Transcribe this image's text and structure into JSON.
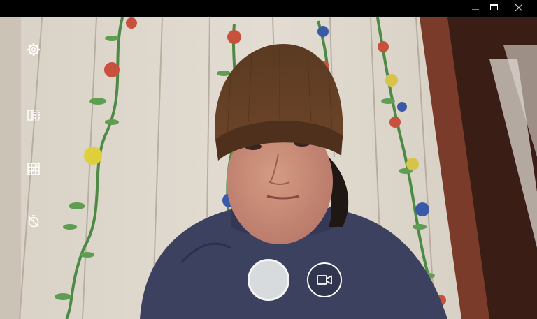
{
  "window": {
    "controls": {
      "minimize_icon": "minimize-icon",
      "maximize_icon": "maximize-icon",
      "close_icon": "close-icon"
    }
  },
  "camera": {
    "left_tools": [
      {
        "id": "settings",
        "icon": "gear-icon"
      },
      {
        "id": "mirror",
        "icon": "mirror-icon"
      },
      {
        "id": "grid",
        "icon": "grid-icon"
      },
      {
        "id": "timer",
        "icon": "timer-off-icon"
      }
    ],
    "capture": {
      "photo_icon": "shutter",
      "video_icon": "video-camera-icon"
    }
  },
  "colors": {
    "titlebar": "#000000",
    "close_button_bg": "#e6e6e6",
    "shutter_fill": "#d8dbdd",
    "wall": "#ddd6cc",
    "hat": "#5e3a22",
    "sweater": "#3c4160",
    "door": "#7a3b2a"
  }
}
